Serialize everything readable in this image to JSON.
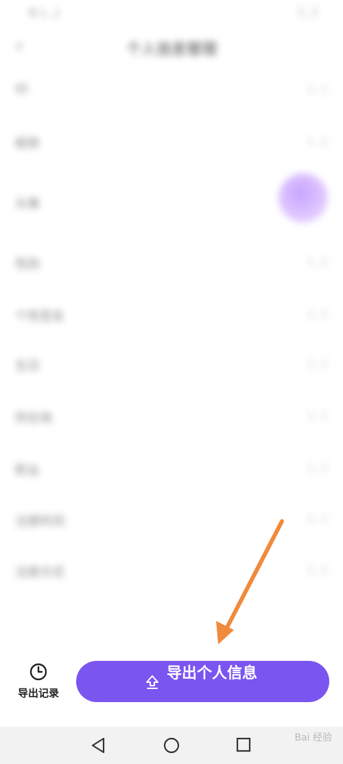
{
  "statusbar": {
    "left": "令 [...]",
    "right": "[...]"
  },
  "header": {
    "title": "个人信息管理"
  },
  "rows": [
    {
      "label": "ID",
      "value": "[...]"
    },
    {
      "label": "昵称",
      "value": "[...]"
    },
    {
      "label": "头像",
      "value": ""
    },
    {
      "label": "性别",
      "value": "[...]"
    },
    {
      "label": "个性签名",
      "value": "[...]"
    },
    {
      "label": "生日",
      "value": "[...]"
    },
    {
      "label": "所在地",
      "value": "[...]"
    },
    {
      "label": "职业",
      "value": "[...]"
    },
    {
      "label": "注册时间",
      "value": "[...]"
    },
    {
      "label": "注册方式",
      "value": "[...]"
    }
  ],
  "bottom": {
    "history_label": "导出记录",
    "export_label": "导出个人信息"
  },
  "watermark": "Bai 经验",
  "colors": {
    "accent": "#7b55f0",
    "annotation_arrow": "#f08a3c"
  }
}
